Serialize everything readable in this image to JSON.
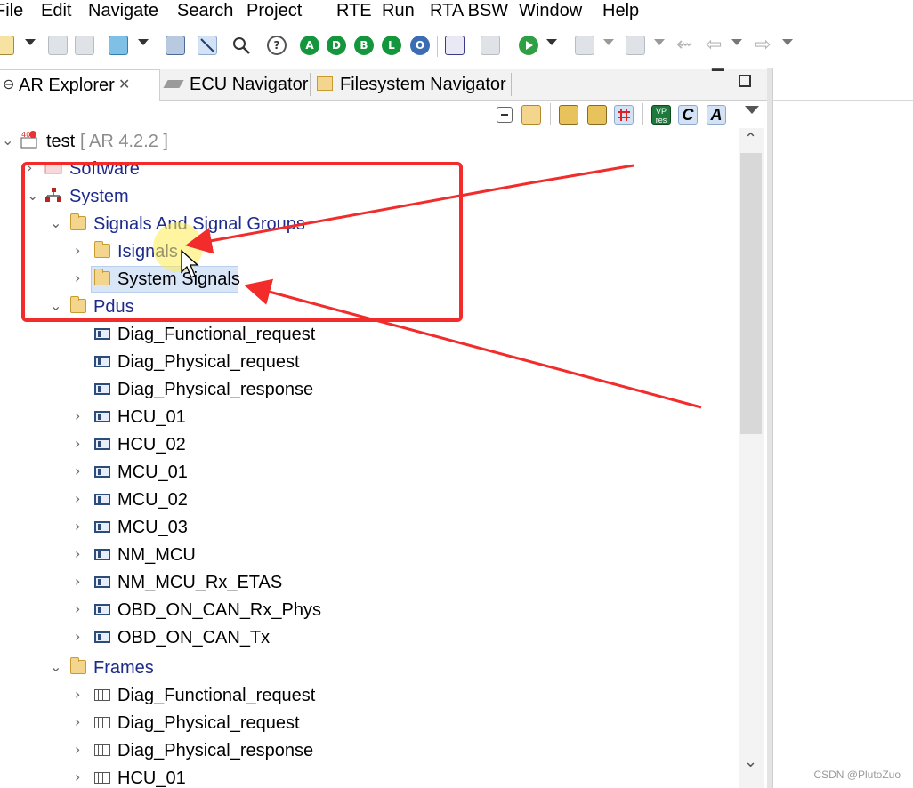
{
  "menu": [
    "File",
    "Edit",
    "Navigate",
    "Search",
    "Project",
    "RTE",
    "Run",
    "RTA BSW",
    "Window",
    "Help"
  ],
  "toolbar": {
    "circle_buttons": [
      {
        "letter": "A",
        "color": "#14963c"
      },
      {
        "letter": "D",
        "color": "#14963c"
      },
      {
        "letter": "B",
        "color": "#14963c"
      },
      {
        "letter": "L",
        "color": "#14963c"
      },
      {
        "letter": "O",
        "color": "#3a6db4"
      }
    ],
    "help_glyph": "?"
  },
  "tabs": [
    {
      "label": "AR Explorer",
      "active": true,
      "closable": true
    },
    {
      "label": "ECU Navigator",
      "active": false
    },
    {
      "label": "Filesystem Navigator",
      "active": false
    }
  ],
  "view_toolbar": {
    "vp_label_top": "VP",
    "vp_label_bottom": "res",
    "c_label": "C",
    "a_label": "A"
  },
  "tree": {
    "root": {
      "label": "test",
      "version": "[ AR 4.2.2 ]"
    },
    "items": [
      {
        "label": "Software",
        "icon": "software-icon",
        "expanded": false
      },
      {
        "label": "System",
        "icon": "system-icon",
        "expanded": true
      },
      {
        "label": "Signals And Signal Groups",
        "icon": "folder-icon",
        "expanded": true
      },
      {
        "label": "Isignals",
        "icon": "folder-icon",
        "expanded": false
      },
      {
        "label": "System Signals",
        "icon": "folder-icon",
        "expanded": false,
        "selected": true
      },
      {
        "label": "Pdus",
        "icon": "folder-icon",
        "expanded": true
      },
      {
        "label": "Diag_Functional_request",
        "icon": "pdu-icon"
      },
      {
        "label": "Diag_Physical_request",
        "icon": "pdu-icon"
      },
      {
        "label": "Diag_Physical_response",
        "icon": "pdu-icon"
      },
      {
        "label": "HCU_01",
        "icon": "pdu-icon"
      },
      {
        "label": "HCU_02",
        "icon": "pdu-icon"
      },
      {
        "label": "MCU_01",
        "icon": "pdu-icon"
      },
      {
        "label": "MCU_02",
        "icon": "pdu-icon"
      },
      {
        "label": "MCU_03",
        "icon": "pdu-icon"
      },
      {
        "label": "NM_MCU",
        "icon": "pdu-icon"
      },
      {
        "label": "NM_MCU_Rx_ETAS",
        "icon": "pdu-icon"
      },
      {
        "label": "OBD_ON_CAN_Rx_Phys",
        "icon": "pdu-icon"
      },
      {
        "label": "OBD_ON_CAN_Tx",
        "icon": "pdu-icon"
      },
      {
        "label": "Frames",
        "icon": "folder-icon",
        "expanded": true
      },
      {
        "label": "Diag_Functional_request",
        "icon": "frame-icon"
      },
      {
        "label": "Diag_Physical_request",
        "icon": "frame-icon"
      },
      {
        "label": "Diag_Physical_response",
        "icon": "frame-icon"
      },
      {
        "label": "HCU_01",
        "icon": "frame-icon"
      }
    ]
  },
  "watermark": "CSDN @PlutoZuo",
  "annotation_color": "#f22b2b"
}
